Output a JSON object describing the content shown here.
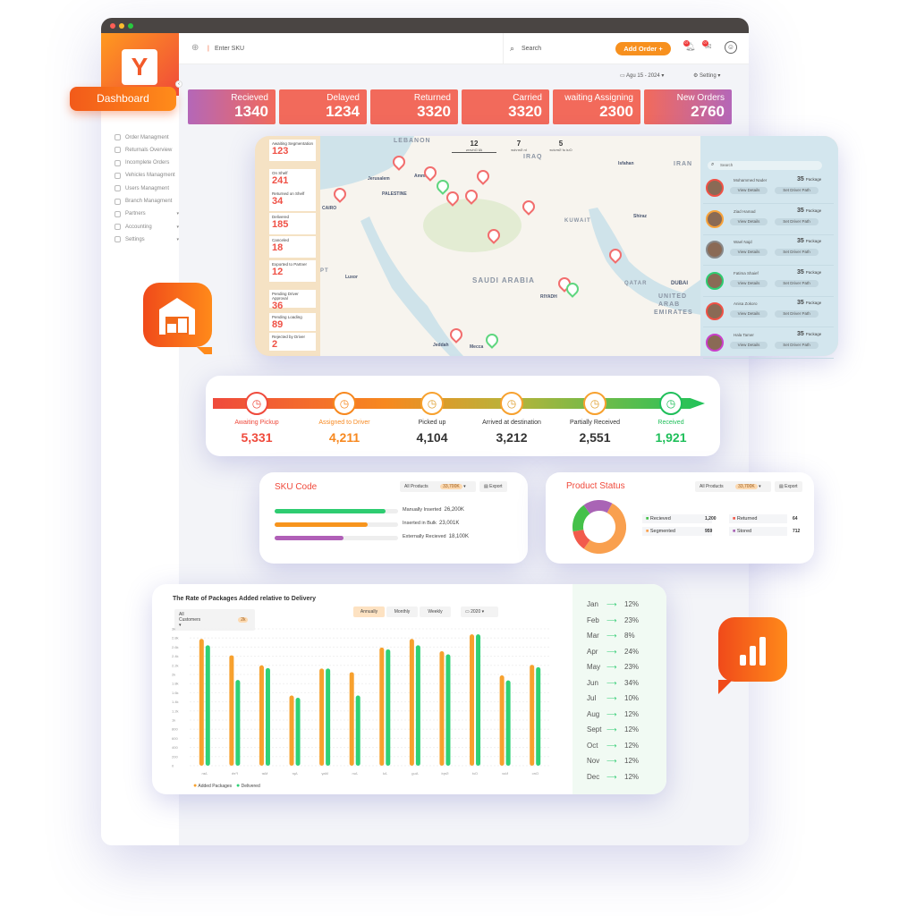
{
  "header": {
    "sku_placeholder": "Enter SKU",
    "search_placeholder": "Search",
    "add_order": "Add Order +",
    "date": "Agu 15 - 2024",
    "setting": "Setting",
    "notif_count": "07",
    "msg_count": "07"
  },
  "dashboard_label": "Dashboard",
  "sidebar": {
    "items": [
      {
        "label": "Order Managment"
      },
      {
        "label": "Returnals Overview"
      },
      {
        "label": "Incomplete Orders"
      },
      {
        "label": "Vehicles Managment"
      },
      {
        "label": "Users Managment"
      },
      {
        "label": "Branch Managment"
      },
      {
        "label": "Partners",
        "caret": "▾"
      },
      {
        "label": "Accounting",
        "caret": "▾"
      },
      {
        "label": "Settings",
        "caret": "▾"
      }
    ]
  },
  "kpis": [
    {
      "label": "Recieved",
      "value": "1340"
    },
    {
      "label": "Delayed",
      "value": "1234"
    },
    {
      "label": "Returned",
      "value": "3320"
    },
    {
      "label": "Carried",
      "value": "3320"
    },
    {
      "label": "waiting Assigning",
      "value": "2300"
    },
    {
      "label": "New Orders",
      "value": "2760"
    }
  ],
  "stats": [
    {
      "label": "Awaiting Segmentation",
      "value": "123"
    },
    {
      "label": "On Shelf",
      "value": "241"
    },
    {
      "label": "Returned on Shelf",
      "value": "34"
    },
    {
      "label": "Delivered",
      "value": "185"
    },
    {
      "label": "Canceled",
      "value": "18"
    },
    {
      "label": "Exported to Partner",
      "value": "12"
    },
    {
      "label": "Pending Driver Approval",
      "value": "36"
    },
    {
      "label": "Pending Loading",
      "value": "89"
    },
    {
      "label": "Rejected by Driver",
      "value": "2"
    }
  ],
  "map": {
    "labels": [
      "LEBANON",
      "IRAQ",
      "IRAN",
      "Isfahan",
      "Jerusalem",
      "Amman",
      "PALESTINE",
      "CAIRO",
      "KUWAIT",
      "Shiraz",
      "Luxor",
      "SAUDI ARABIA",
      "RIYADH",
      "QATAR",
      "DUBAI",
      "UNITED",
      "ARAB",
      "EMIRATES",
      "Jeddah",
      "Mecca",
      "PT"
    ]
  },
  "drivers": {
    "tabs": [
      {
        "count": "12",
        "label": "All Drivers"
      },
      {
        "count": "7",
        "label": "In Service"
      },
      {
        "count": "5",
        "label": "Out of Service"
      }
    ],
    "search_placeholder": "Search",
    "view_label": "View Details",
    "path_label": "Set Driver Path",
    "unit": "Package",
    "list": [
      {
        "name": "Mohammed Nader",
        "packages": "35",
        "color": "#ef5146"
      },
      {
        "name": "Ziad Hamad",
        "packages": "35",
        "color": "#f7a23a"
      },
      {
        "name": "Wael Najd",
        "packages": "35",
        "color": "#888888"
      },
      {
        "name": "Fatima Shaief",
        "packages": "35",
        "color": "#2ecc71"
      },
      {
        "name": "Anisa Zokoro",
        "packages": "35",
        "color": "#ef5146"
      },
      {
        "name": "Hala Tamer",
        "packages": "35",
        "color": "#c93fc9"
      }
    ]
  },
  "pipeline": [
    {
      "label": "Awaiting Pickup",
      "value": "5,331",
      "color": "#ef4a3c",
      "icon": "history-icon"
    },
    {
      "label": "Assigned to Driver",
      "value": "4,211",
      "color": "#f7881f",
      "icon": "driver-icon"
    },
    {
      "label": "Picked up",
      "value": "4,104",
      "color": "#333333",
      "icon": "forklift-icon"
    },
    {
      "label": "Arrived at destination",
      "value": "3,212",
      "color": "#333333",
      "icon": "route-icon"
    },
    {
      "label": "Partially Received",
      "value": "2,551",
      "color": "#333333",
      "icon": "battery-icon"
    },
    {
      "label": "Received",
      "value": "1,921",
      "color": "#1fbf5a",
      "icon": "box-check-icon"
    }
  ],
  "sku": {
    "title": "SKU Code",
    "filter": "All Products",
    "filter_badge": "33,700K",
    "export": "Export",
    "bars": [
      {
        "label": "Manually Inserted",
        "value": "26,200K",
        "fill": 0.9,
        "color": "#2ecc71"
      },
      {
        "label": "Inserted in Bulk",
        "value": "23,001K",
        "fill": 0.75,
        "color": "#f7941d"
      },
      {
        "label": "Externally Recieved",
        "value": "18,100K",
        "fill": 0.56,
        "color": "#b05fb7"
      }
    ]
  },
  "product_status": {
    "title": "Product Status",
    "filter": "All Products",
    "filter_badge": "33,700K",
    "export": "Export",
    "items": [
      {
        "label": "Recieved",
        "value": "1,200",
        "color": "#45c14a"
      },
      {
        "label": "Returned",
        "value": "64",
        "color": "#f25a4c"
      },
      {
        "label": "Segmented",
        "value": "959",
        "color": "#f9a04f"
      },
      {
        "label": "Stored",
        "value": "712",
        "color": "#a964b5"
      }
    ],
    "donut": [
      {
        "name": "Segmented",
        "value": 959,
        "color": "#f9a04f"
      },
      {
        "name": "Returned",
        "value": 230,
        "color": "#f25a4c"
      },
      {
        "name": "Recieved",
        "value": 330,
        "color": "#45c14a"
      },
      {
        "name": "Stored",
        "value": 330,
        "color": "#a964b5"
      }
    ]
  },
  "chart_data": {
    "type": "bar",
    "title": "The Rate of Packages Added relative to Delivery",
    "filter": "All Customers",
    "filter_badge": "2k",
    "tabs": [
      "Annually",
      "Monthly",
      "Weekly"
    ],
    "active_tab": "Annually",
    "year": "2020",
    "categories": [
      "Jan",
      "Feb",
      "Mar",
      "Apr",
      "May",
      "Jun",
      "Jul",
      "Aug",
      "Sept",
      "Oct",
      "Nov",
      "Dec"
    ],
    "series": [
      {
        "name": "Added Packages",
        "color": "#f7a12e",
        "values": [
          2780,
          2420,
          2200,
          1540,
          2130,
          2050,
          2590,
          2780,
          2510,
          2880,
          1980,
          2210
        ]
      },
      {
        "name": "Delivered",
        "color": "#2fd176",
        "values": [
          2640,
          1880,
          2140,
          1490,
          2130,
          1540,
          2550,
          2640,
          2440,
          2880,
          1870,
          2160
        ]
      }
    ],
    "yticks": [
      "0",
      "200",
      "400",
      "600",
      "800",
      "1k",
      "1.2k",
      "1.4k",
      "1.6k",
      "1.8k",
      "2k",
      "2.2k",
      "2.4k",
      "2.6k",
      "2.8k",
      "3k"
    ],
    "ylim": [
      0,
      3000
    ],
    "grid": true,
    "legend": "bottom-left"
  },
  "monthly_rates": [
    {
      "month": "Jan",
      "rate": "12%"
    },
    {
      "month": "Feb",
      "rate": "23%"
    },
    {
      "month": "Mar",
      "rate": "8%"
    },
    {
      "month": "Apr",
      "rate": "24%"
    },
    {
      "month": "May",
      "rate": "23%"
    },
    {
      "month": "Jun",
      "rate": "34%"
    },
    {
      "month": "Jul",
      "rate": "10%"
    },
    {
      "month": "Aug",
      "rate": "12%"
    },
    {
      "month": "Sept",
      "rate": "12%"
    },
    {
      "month": "Oct",
      "rate": "12%"
    },
    {
      "month": "Nov",
      "rate": "12%"
    },
    {
      "month": "Dec",
      "rate": "12%"
    }
  ]
}
